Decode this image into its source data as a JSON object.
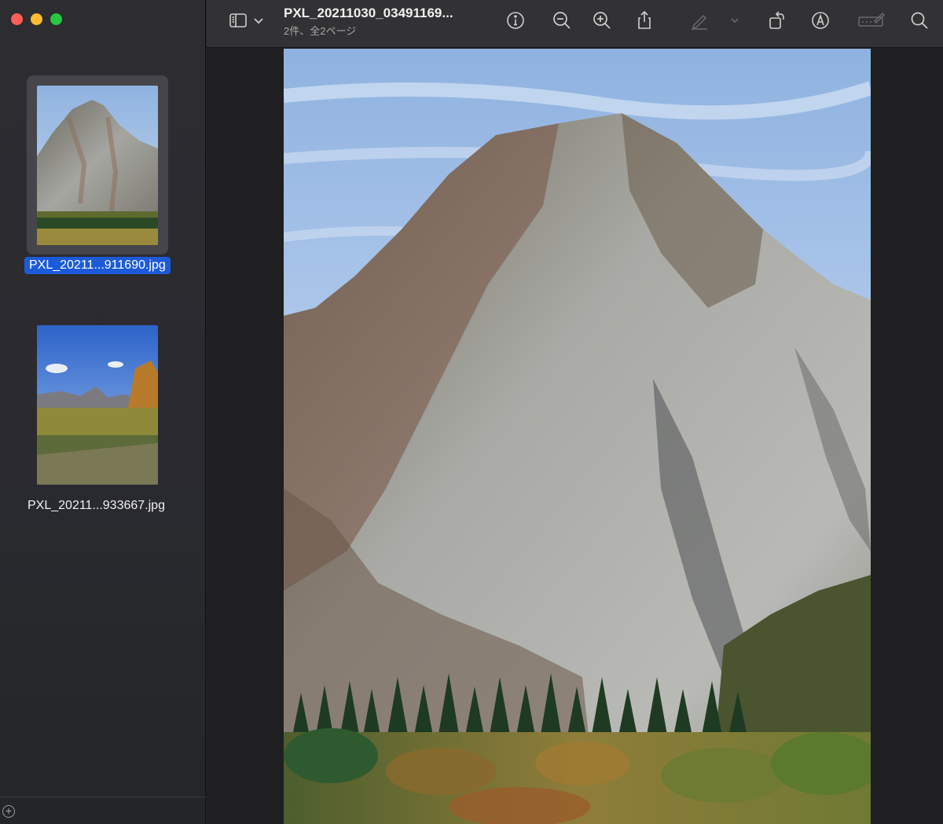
{
  "window": {
    "controls": [
      "close",
      "minimize",
      "zoom"
    ]
  },
  "toolbar": {
    "title": "PXL_20211030_03491169...",
    "subtitle": "2件、全2ページ",
    "icons": [
      "sidebar-icon",
      "chevron-down-icon",
      "info-icon",
      "zoom-out-icon",
      "zoom-in-icon",
      "share-icon",
      "highlight-pen-icon",
      "chevron-down-icon",
      "rotate-icon",
      "markup-icon",
      "form-fill-icon",
      "search-icon"
    ]
  },
  "sidebar": {
    "items": [
      {
        "label": "PXL_20211...911690.jpg",
        "selected": true
      },
      {
        "label": "PXL_20211...933667.jpg",
        "selected": false
      }
    ]
  },
  "colors": {
    "selection": "#1c5ad8",
    "window_bg": "#232325",
    "toolbar_bg": "#323234"
  }
}
